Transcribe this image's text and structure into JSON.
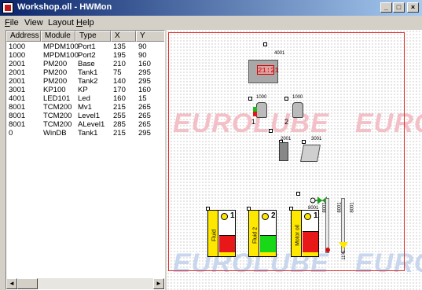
{
  "window": {
    "title": "Workshop.oll - HWMon"
  },
  "title_buttons": {
    "minimize": "_",
    "maximize": "□",
    "close": "×"
  },
  "menu": [
    {
      "label": "File",
      "ul": "F",
      "rest": "ile"
    },
    {
      "label": "View",
      "ul": "",
      "rest": "View"
    },
    {
      "label": "Layout",
      "ul": "",
      "rest": "Layout"
    },
    {
      "label": "Help",
      "ul": "H",
      "rest": "elp"
    }
  ],
  "table": {
    "columns": [
      "Address",
      "Module",
      "Type",
      "X",
      "Y"
    ],
    "rows": [
      [
        "1000",
        "MPDM100",
        "Port1",
        "135",
        "90"
      ],
      [
        "1000",
        "MPDM100",
        "Port2",
        "195",
        "90"
      ],
      [
        "2001",
        "PM200",
        "Base",
        "210",
        "160"
      ],
      [
        "2001",
        "PM200",
        "Tank1",
        "75",
        "295"
      ],
      [
        "2001",
        "PM200",
        "Tank2",
        "140",
        "295"
      ],
      [
        "3001",
        "KP100",
        "KP",
        "170",
        "160"
      ],
      [
        "4001",
        "LED101",
        "Led",
        "160",
        "15"
      ],
      [
        "8001",
        "TCM200",
        "Mv1",
        "215",
        "265"
      ],
      [
        "8001",
        "TCM200",
        "Level1",
        "255",
        "265"
      ],
      [
        "8001",
        "TCM200",
        "ALevel1",
        "285",
        "265"
      ],
      [
        "0",
        "WinDB",
        "Tank1",
        "215",
        "295"
      ]
    ]
  },
  "scrollbar": {
    "left_arrow": "◄",
    "right_arrow": "►"
  },
  "canvas": {
    "watermark": "EUROLUBE",
    "clock": {
      "time": "21:21",
      "address": "4001"
    },
    "ports": {
      "port1_address": "1000",
      "port2_address": "1000",
      "port1_num": "1",
      "port2_num": "2"
    },
    "base_address": "2001",
    "kp_address": "3001",
    "valve_address": "8001",
    "sensor_labels": [
      "8001",
      "8001",
      "8001"
    ],
    "level_value": "11%",
    "tanks": [
      {
        "label": "Fluid",
        "num": "1",
        "fill_color": "#e81818",
        "level": 0.4
      },
      {
        "label": "Fluid 2",
        "num": "2",
        "fill_color": "#18d818",
        "level": 0.4
      },
      {
        "label": "Motor oil",
        "num": "1",
        "fill_color": "#e81818",
        "level": 0.5
      }
    ]
  }
}
